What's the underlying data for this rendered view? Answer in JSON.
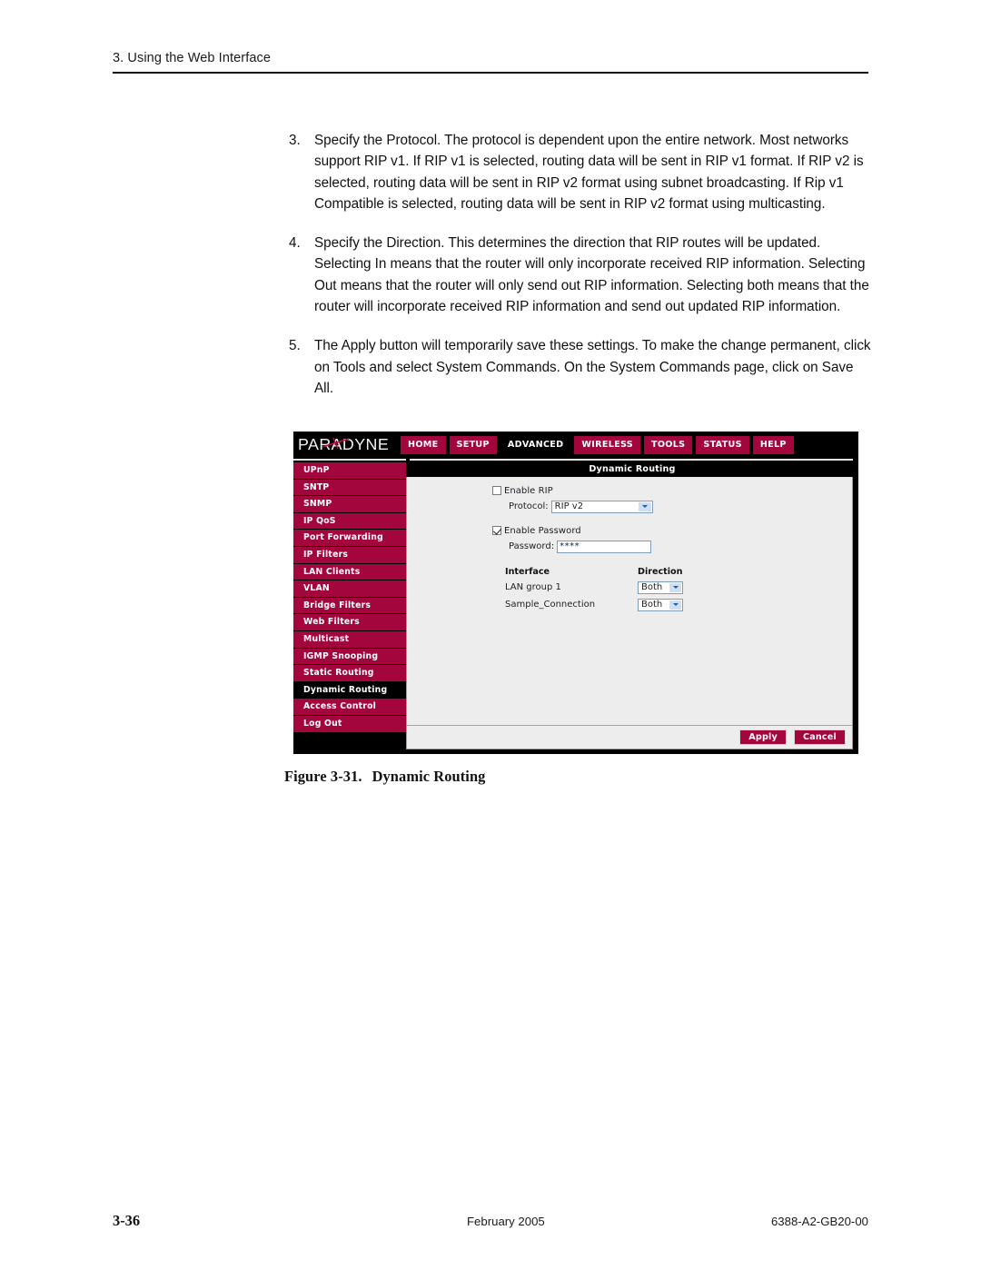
{
  "page_header": {
    "text": "3. Using the Web Interface"
  },
  "steps": [
    {
      "number": "3.",
      "text": "Specify the Protocol. The protocol is dependent upon the entire network. Most networks support RIP v1. If RIP v1 is selected, routing data will be sent in RIP v1 format. If RIP v2 is selected, routing data will be sent in RIP v2 format using subnet broadcasting. If Rip v1 Compatible is selected, routing data will be sent in RIP v2 format using multicasting."
    },
    {
      "number": "4.",
      "text": "Specify the Direction. This determines the direction that RIP routes will be updated. Selecting In means that the router will only incorporate received RIP information. Selecting Out means that the router will only send out RIP information. Selecting both means that the router will incorporate received RIP information and send out updated RIP information."
    },
    {
      "number": "5.",
      "text": "The Apply button will temporarily save these settings. To make the change permanent, click on Tools and select System Commands. On the System Commands page, click on Save All."
    }
  ],
  "screenshot": {
    "brand": "PARADYNE",
    "nav_tabs": [
      {
        "label": "HOME",
        "active": false
      },
      {
        "label": "SETUP",
        "active": false
      },
      {
        "label": "ADVANCED",
        "active": true
      },
      {
        "label": "WIRELESS",
        "active": false
      },
      {
        "label": "TOOLS",
        "active": false
      },
      {
        "label": "STATUS",
        "active": false
      },
      {
        "label": "HELP",
        "active": false
      }
    ],
    "sidebar": [
      {
        "label": "UPnP",
        "active": false
      },
      {
        "label": "SNTP",
        "active": false
      },
      {
        "label": "SNMP",
        "active": false
      },
      {
        "label": "IP QoS",
        "active": false
      },
      {
        "label": "Port Forwarding",
        "active": false
      },
      {
        "label": "IP Filters",
        "active": false
      },
      {
        "label": "LAN Clients",
        "active": false
      },
      {
        "label": "VLAN",
        "active": false
      },
      {
        "label": "Bridge Filters",
        "active": false
      },
      {
        "label": "Web Filters",
        "active": false
      },
      {
        "label": "Multicast",
        "active": false
      },
      {
        "label": "IGMP Snooping",
        "active": false
      },
      {
        "label": "Static Routing",
        "active": false
      },
      {
        "label": "Dynamic Routing",
        "active": true
      },
      {
        "label": "Access Control",
        "active": false
      },
      {
        "label": "Log Out",
        "active": false
      }
    ],
    "content_title": "Dynamic Routing",
    "form": {
      "enable_rip_label": "Enable RIP",
      "enable_rip_checked": false,
      "protocol_label": "Protocol:",
      "protocol_value": "RIP v2",
      "enable_password_label": "Enable Password",
      "enable_password_checked": true,
      "password_label": "Password:",
      "password_value": "****"
    },
    "interface_table": {
      "headers": [
        "Interface",
        "Direction"
      ],
      "rows": [
        {
          "interface": "LAN group 1",
          "direction": "Both"
        },
        {
          "interface": "Sample_Connection",
          "direction": "Both"
        }
      ]
    },
    "buttons": {
      "apply": "Apply",
      "cancel": "Cancel"
    },
    "colors": {
      "brand_red": "#a3063c",
      "panel_bg": "#ededed",
      "chrome_black": "#000000"
    }
  },
  "figure_caption": {
    "label": "Figure 3-31.",
    "title": "Dynamic Routing"
  },
  "footer": {
    "page_number": "3-36",
    "date": "February 2005",
    "document_id": "6388-A2-GB20-00"
  }
}
